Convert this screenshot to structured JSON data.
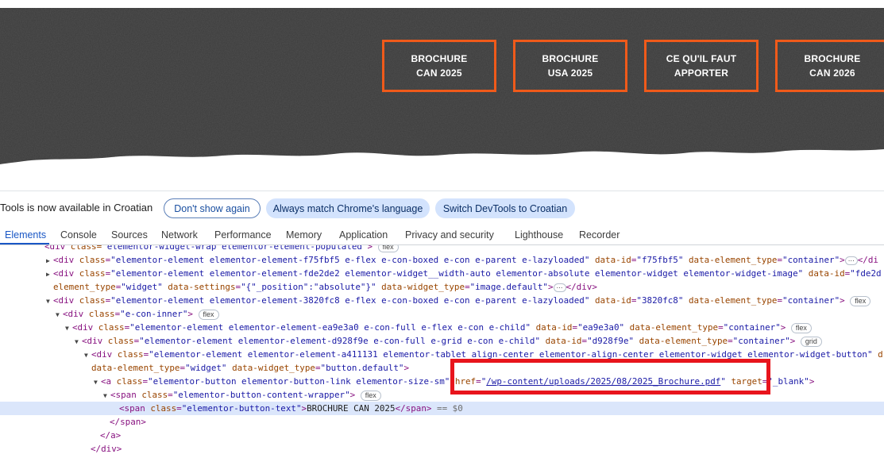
{
  "site": {
    "tiny_top": "",
    "buttons": [
      {
        "label": "BROCHURE\nCAN 2025"
      },
      {
        "label": "BROCHURE\nUSA 2025"
      },
      {
        "label": "CE QU'IL FAUT\nAPPORTER"
      },
      {
        "label": "BROCHURE\nCAN 2026"
      }
    ],
    "accent_color": "#f05a1a",
    "banner_color": "#3a3a3a"
  },
  "infobar": {
    "message": "Tools is now available in Croatian",
    "dont_show": "Don't show again",
    "always_match": "Always match Chrome's language",
    "switch": "Switch DevTools to Croatian"
  },
  "tabs": [
    {
      "label": "Elements",
      "active": true
    },
    {
      "label": "Console"
    },
    {
      "label": "Sources"
    },
    {
      "label": "Network"
    },
    {
      "label": "Performance"
    },
    {
      "label": "Memory"
    },
    {
      "label": "Application"
    },
    {
      "label": "Privacy and security"
    },
    {
      "label": "Lighthouse"
    },
    {
      "label": "Recorder"
    }
  ],
  "dom": {
    "l0_open": "<div ",
    "l0_attr": "class=",
    "l0_val": "\"elementor-widget-wrap elementor-element-populated\"",
    "l0_close": ">",
    "l0_pill": "flex",
    "l1_attrs": [
      {
        "n": "class",
        "v": "\"elementor-element elementor-element-f75fbf5 e-flex e-con-boxed e-con e-parent e-lazyloaded\""
      },
      {
        "n": "data-id",
        "v": "\"f75fbf5\""
      },
      {
        "n": "data-element_type",
        "v": "\"container\""
      }
    ],
    "l1_end": "</di",
    "l2_attrs": [
      {
        "n": "class",
        "v": "\"elementor-element elementor-element-fde2de2 elementor-widget__width-auto elementor-absolute elementor-widget elementor-widget-image\""
      },
      {
        "n": "data-id",
        "v": "\"fde2d"
      }
    ],
    "l3_part1_n": "element_type",
    "l3_part1_v": "\"widget\"",
    "l3_part2_n": "data-settings",
    "l3_part2_v": "\"{\"_position\":\"absolute\"}\"",
    "l3_part3_n": "data-widget_type",
    "l3_part3_v": "\"image.default\"",
    "l3_end": "</div>",
    "l4_attrs": [
      {
        "n": "class",
        "v": "\"elementor-element elementor-element-3820fc8 e-flex e-con-boxed e-con e-parent e-lazyloaded\""
      },
      {
        "n": "data-id",
        "v": "\"3820fc8\""
      },
      {
        "n": "data-element_type",
        "v": "\"container\""
      }
    ],
    "l4_pill": "flex",
    "l5_class": "\"e-con-inner\"",
    "l5_pill": "flex",
    "l6_attrs": [
      {
        "n": "class",
        "v": "\"elementor-element elementor-element-ea9e3a0 e-con-full e-flex e-con e-child\""
      },
      {
        "n": "data-id",
        "v": "\"ea9e3a0\""
      },
      {
        "n": "data-element_type",
        "v": "\"container\""
      }
    ],
    "l6_pill": "flex",
    "l7_attrs": [
      {
        "n": "class",
        "v": "\"elementor-element elementor-element-d928f9e e-con-full e-grid e-con e-child\""
      },
      {
        "n": "data-id",
        "v": "\"d928f9e\""
      },
      {
        "n": "data-element_type",
        "v": "\"container\""
      }
    ],
    "l7_pill": "grid",
    "l8_class": "\"elementor-element elementor-element-a411131 elementor-tablet_align-center elementor-align-center elementor-widget elementor-widget-button\"",
    "l8_tail": " d",
    "l9_n1": "data-element_type",
    "l9_v1": "\"widget\"",
    "l9_n2": "data-widget_type",
    "l9_v2": "\"button.default\"",
    "l10_class": "\"elementor-button elementor-button-link elementor-size-sm\"",
    "l10_href_n": "href",
    "l10_href_v": "/wp-content/uploads/2025/08/2025_Brochure.pdf",
    "l10_target_n": "target",
    "l10_target_v": "\"_blank\"",
    "l11_class": "\"elementor-button-content-wrapper\"",
    "l11_pill": "flex",
    "l12_class": "\"elementor-button-text\"",
    "l12_text": "BROCHURE CAN 2025",
    "l12_eq": " == $0",
    "l13": "</span>",
    "l14": "</a>",
    "l15": "</div>"
  }
}
